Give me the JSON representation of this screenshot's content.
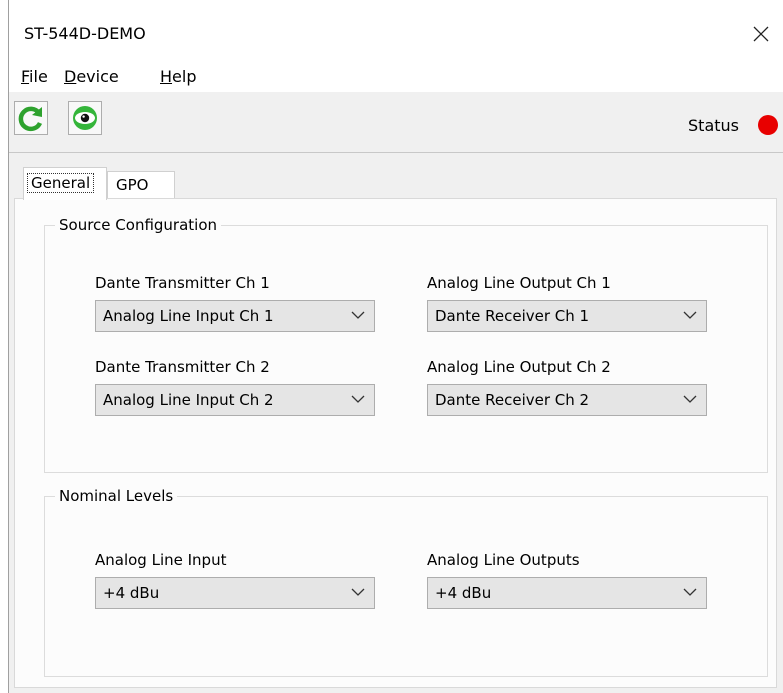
{
  "window": {
    "title": "ST-544D-DEMO"
  },
  "menu": {
    "items": [
      {
        "first": "F",
        "rest": "ile"
      },
      {
        "first": "D",
        "rest": "evice"
      },
      {
        "first": "H",
        "rest": "elp"
      }
    ]
  },
  "toolbar": {
    "status_label": "Status",
    "status_color": "#e80000"
  },
  "tabs": {
    "general": "General",
    "gpo": "GPO"
  },
  "source_config": {
    "title": "Source Configuration",
    "dante_tx_ch1": {
      "label": "Dante Transmitter Ch 1",
      "value": "Analog Line Input Ch 1"
    },
    "analog_out_ch1": {
      "label": "Analog Line Output Ch 1",
      "value": "Dante Receiver Ch 1"
    },
    "dante_tx_ch2": {
      "label": "Dante Transmitter Ch 2",
      "value": "Analog Line Input Ch 2"
    },
    "analog_out_ch2": {
      "label": "Analog Line Output Ch 2",
      "value": "Dante Receiver Ch 2"
    }
  },
  "nominal_levels": {
    "title": "Nominal Levels",
    "analog_input": {
      "label": "Analog Line Input",
      "value": "+4 dBu"
    },
    "analog_outputs": {
      "label": "Analog Line Outputs",
      "value": "+4 dBu"
    }
  }
}
